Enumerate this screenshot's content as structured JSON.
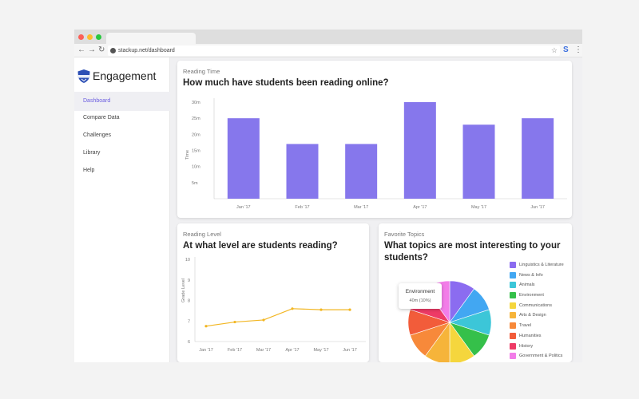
{
  "browser": {
    "url": "stackup.net/dashboard",
    "back_icon": "←",
    "forward_icon": "→",
    "reload_icon": "↻",
    "star_icon": "☆",
    "extension_icon": "S",
    "menu_icon": "⋮"
  },
  "sidebar": {
    "title": "Engagement",
    "items": [
      {
        "label": "Dashboard"
      },
      {
        "label": "Compare Data"
      },
      {
        "label": "Challenges"
      },
      {
        "label": "Library"
      },
      {
        "label": "Help"
      }
    ]
  },
  "colors": {
    "accent": "#6a5ce0",
    "bar": "#8677ec",
    "line": "#f2b622"
  },
  "reading_time": {
    "subtitle": "Reading Time",
    "title": "How much have students been reading online?"
  },
  "reading_level": {
    "subtitle": "Reading Level",
    "title": "At what level are students reading?"
  },
  "favorite_topics": {
    "subtitle": "Favorite Topics",
    "title_line1": "What topics are most interesting to your",
    "title_line2": "students?",
    "tooltip": {
      "title": "Environment",
      "value": "40m (10%)"
    }
  },
  "chart_data": [
    {
      "type": "bar",
      "categories": [
        "Jan '17",
        "Feb '17",
        "Mar '17",
        "Apr '17",
        "May '17",
        "Jun '17"
      ],
      "values": [
        25,
        17,
        17,
        30,
        23,
        25
      ],
      "ylabel": "Time",
      "ylim": [
        0,
        30
      ],
      "yticks": [
        "5m",
        "10m",
        "15m",
        "20m",
        "25m",
        "30m"
      ],
      "ytick_values": [
        5,
        10,
        15,
        20,
        25,
        30
      ],
      "grid": false
    },
    {
      "type": "line",
      "categories": [
        "Jan '17",
        "Feb '17",
        "Mar '17",
        "Apr '17",
        "May '17",
        "Jun '17"
      ],
      "values": [
        6.75,
        6.95,
        7.05,
        7.6,
        7.55,
        7.55
      ],
      "ylabel": "Grade Level",
      "ylim": [
        6,
        10
      ],
      "yticks": [
        "6",
        "7",
        "8",
        "9",
        "10"
      ],
      "ytick_values": [
        6,
        7,
        8,
        9,
        10
      ],
      "grid": false
    },
    {
      "type": "pie",
      "labels": [
        "Linguistics & Literature",
        "News & Info",
        "Animals",
        "Environment",
        "Communications",
        "Arts & Design",
        "Travel",
        "Humanities",
        "History",
        "Government & Politics"
      ],
      "values": [
        10,
        10,
        10,
        10,
        10,
        10,
        10,
        10,
        10,
        10
      ],
      "colors": [
        "#8b6cf0",
        "#42a7f2",
        "#3cc6d8",
        "#35c04a",
        "#f5d63d",
        "#f6b43a",
        "#f7893a",
        "#f25c3a",
        "#ee3b66",
        "#f27de8"
      ],
      "legend": "right"
    }
  ]
}
